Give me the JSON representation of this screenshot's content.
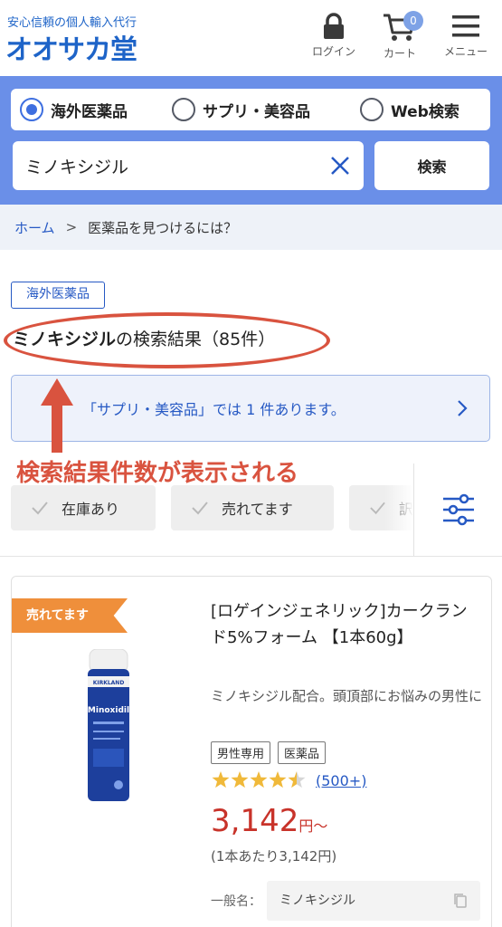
{
  "header": {
    "tagline": "安心信頼の個人輸入代行",
    "logo": "オオサカ堂",
    "login_label": "ログイン",
    "cart_label": "カート",
    "cart_count": "0",
    "menu_label": "メニュー"
  },
  "search": {
    "radios": [
      {
        "label": "海外医薬品",
        "selected": true
      },
      {
        "label": "サプリ・美容品",
        "selected": false
      },
      {
        "label": "Web検索",
        "selected": false
      }
    ],
    "query": "ミノキシジル",
    "button_label": "検索"
  },
  "breadcrumb": {
    "home": "ホーム",
    "separator": ">",
    "current": "医薬品を見つけるには？"
  },
  "results": {
    "category_tag": "海外医薬品",
    "keyword": "ミノキシジル",
    "suffix": "の検索結果（85件）",
    "alt_notice": "「サプリ・美容品」では 1 件あります。"
  },
  "annotation": {
    "text": "検索結果件数が表示される",
    "color": "#d9533f"
  },
  "filters": {
    "chips": [
      "在庫あり",
      "売れてます",
      "訳"
    ]
  },
  "product": {
    "badge": "売れてます",
    "title": "[ロゲインジェネリック]カークランド5%フォーム 【1本60g】",
    "description": "ミノキシジル配合。頭頂部にお悩みの男性に",
    "tags": [
      "男性専用",
      "医薬品"
    ],
    "rating": 4.5,
    "review_count": "(500+)",
    "price": "3,142",
    "price_suffix": "円〜",
    "unit_price": "(1本あたり3,142円)",
    "generic_label": "一般名：",
    "generic_name": "ミノキシジル",
    "image_label": "Minoxidil",
    "image_brand": "KIRKLAND"
  },
  "colors": {
    "brand_blue": "#1e64c8",
    "search_panel": "#6a8fe8",
    "price_red": "#c8332a",
    "badge_orange": "#ef8f3b",
    "star": "#f0b93a"
  }
}
